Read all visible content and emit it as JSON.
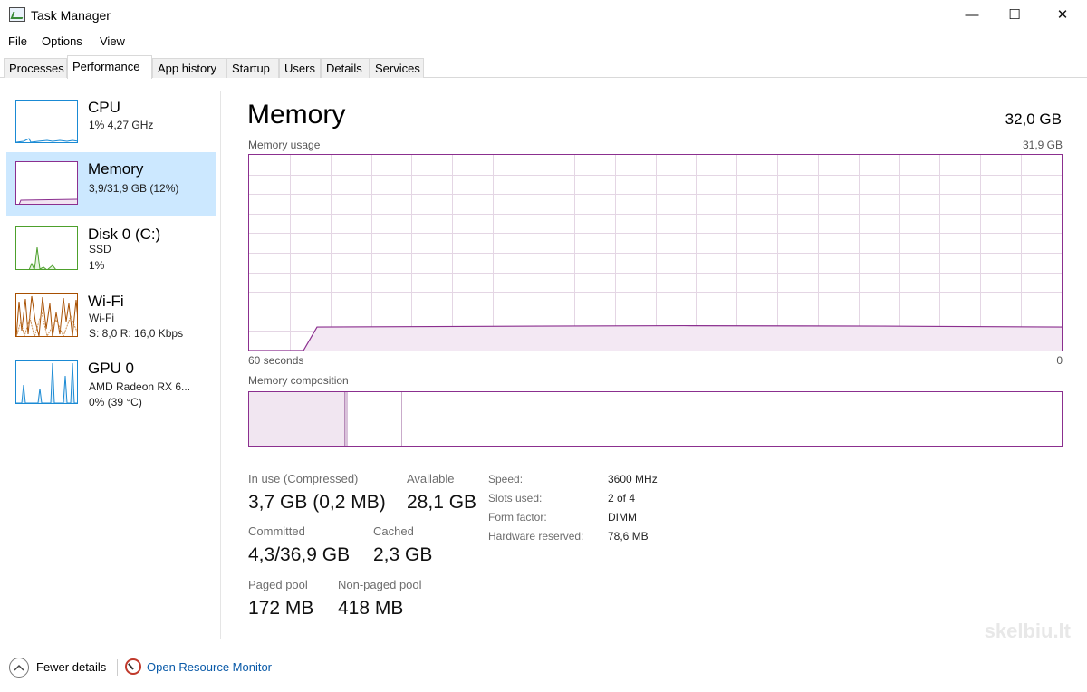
{
  "window": {
    "title": "Task Manager",
    "minimize": "—",
    "maximize": "☐",
    "close": "✕"
  },
  "menu": [
    "File",
    "Options",
    "View"
  ],
  "tabs": [
    "Processes",
    "Performance",
    "App history",
    "Startup",
    "Users",
    "Details",
    "Services"
  ],
  "active_tab": "Performance",
  "sidebar": {
    "items": [
      {
        "name": "CPU",
        "line1": "1% 4,27 GHz",
        "line2": "",
        "color": "#1a8ad4"
      },
      {
        "name": "Memory",
        "line1": "3,9/31,9 GB (12%)",
        "line2": "",
        "color": "#8b2f8f"
      },
      {
        "name": "Disk 0 (C:)",
        "line1": "SSD",
        "line2": "1%",
        "color": "#4da02c"
      },
      {
        "name": "Wi-Fi",
        "line1": "Wi-Fi",
        "line2": "S: 8,0  R: 16,0 Kbps",
        "color": "#a74f01"
      },
      {
        "name": "GPU 0",
        "line1": "AMD Radeon RX 6...",
        "line2": "0% (39 °C)",
        "color": "#1a8ad4"
      }
    ]
  },
  "main": {
    "title": "Memory",
    "total": "32,0 GB",
    "usage_label": "Memory usage",
    "usage_max": "31,9 GB",
    "time_left": "60 seconds",
    "time_right": "0",
    "composition_label": "Memory composition",
    "usage_fraction": 0.12,
    "accent": "#8b2f8f"
  },
  "stats": {
    "in_use_label": "In use (Compressed)",
    "in_use_value": "3,7 GB (0,2 MB)",
    "available_label": "Available",
    "available_value": "28,1 GB",
    "committed_label": "Committed",
    "committed_value": "4,3/36,9 GB",
    "cached_label": "Cached",
    "cached_value": "2,3 GB",
    "paged_label": "Paged pool",
    "paged_value": "172 MB",
    "nonpaged_label": "Non-paged pool",
    "nonpaged_value": "418 MB"
  },
  "info": [
    {
      "label": "Speed:",
      "value": "3600 MHz"
    },
    {
      "label": "Slots used:",
      "value": "2 of 4"
    },
    {
      "label": "Form factor:",
      "value": "DIMM"
    },
    {
      "label": "Hardware reserved:",
      "value": "78,6 MB"
    }
  ],
  "footer": {
    "fewer_details": "Fewer details",
    "open_resource_monitor": "Open Resource Monitor"
  },
  "watermark": "skelbiu.lt"
}
